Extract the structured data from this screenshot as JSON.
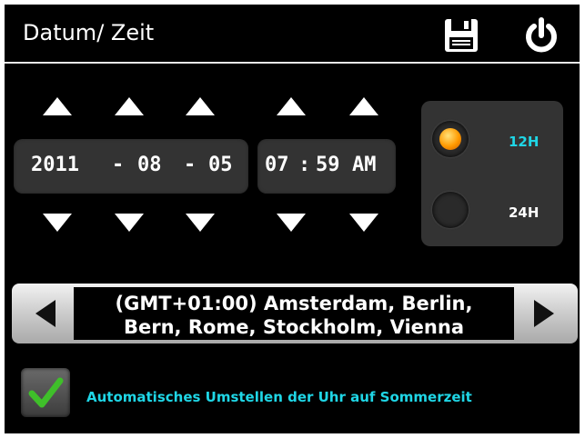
{
  "header": {
    "title": "Datum/ Zeit",
    "save_icon": "save-icon",
    "power_icon": "power-icon"
  },
  "date": {
    "year": "2011",
    "separator1": "-",
    "month": "08",
    "separator2": "-",
    "day": "05"
  },
  "time": {
    "hour": "07",
    "separator": ":",
    "minute": "59",
    "ampm": "AM"
  },
  "format": {
    "options": [
      {
        "label": "12H",
        "selected": true
      },
      {
        "label": "24H",
        "selected": false
      }
    ],
    "selected_color": "#1fd6e6",
    "unselected_color": "#ffffff"
  },
  "timezone": {
    "line1": "(GMT+01:00) Amsterdam, Berlin,",
    "line2": "Bern, Rome, Stockholm, Vienna"
  },
  "dst": {
    "checked": true,
    "label": "Automatisches Umstellen der Uhr auf Sommerzeit"
  },
  "colors": {
    "accent": "#1fd6e6",
    "background": "#000000",
    "panel": "#333333",
    "check_green": "#3fbf2a"
  }
}
